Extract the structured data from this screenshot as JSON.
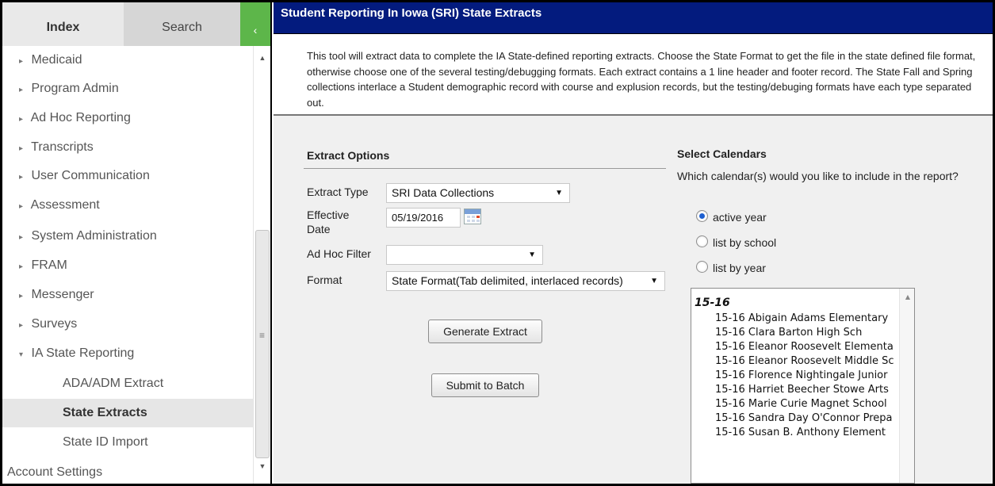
{
  "nav": {
    "tabs": {
      "index": "Index",
      "search": "Search",
      "collapse": "‹"
    },
    "items": [
      {
        "label": "Medicaid",
        "arrow": "▸"
      },
      {
        "label": "Program Admin",
        "arrow": "▸"
      },
      {
        "label": "Ad Hoc Reporting",
        "arrow": "▸"
      },
      {
        "label": "Transcripts",
        "arrow": "▸"
      },
      {
        "label": "User Communication",
        "arrow": "▸"
      },
      {
        "label": "Assessment",
        "arrow": "▸"
      },
      {
        "label": "System Administration",
        "arrow": "▸"
      },
      {
        "label": "FRAM",
        "arrow": "▸"
      },
      {
        "label": "Messenger",
        "arrow": "▸"
      },
      {
        "label": "Surveys",
        "arrow": "▸"
      },
      {
        "label": "IA State Reporting",
        "arrow": "▾"
      }
    ],
    "sub_items": [
      "ADA/ADM Extract",
      "State Extracts",
      "State ID Import"
    ],
    "account_settings": "Account Settings"
  },
  "main": {
    "title": "Student Reporting In Iowa (SRI) State Extracts",
    "description": "This tool will extract data to complete the IA State-defined reporting extracts. Choose the State Format to get the file in the state defined file format, otherwise choose one of the several testing/debugging formats. Each extract contains a 1 line header and footer record. The State Fall and Spring collections interlace a Student demographic record with course and explusion records, but the testing/debuging formats have each type separated out."
  },
  "extract_options": {
    "title": "Extract Options",
    "extract_type_label": "Extract Type",
    "extract_type_value": "SRI Data Collections",
    "effective_date_label": "Effective Date",
    "effective_date_value": "05/19/2016",
    "ad_hoc_filter_label": "Ad Hoc Filter",
    "ad_hoc_filter_value": "",
    "format_label": "Format",
    "format_value": "State Format(Tab delimited, interlaced records)",
    "generate_button": "Generate Extract",
    "submit_button": "Submit to Batch"
  },
  "calendars": {
    "title": "Select Calendars",
    "question": "Which calendar(s) would you like to include in the report?",
    "options": [
      "active year",
      "list by school",
      "list by year"
    ],
    "selected": "active year",
    "group": "15-16",
    "list": [
      "15-16 Abigain Adams Elementary",
      "15-16 Clara Barton High Sch",
      "15-16 Eleanor Roosevelt Elementa",
      "15-16 Eleanor Roosevelt Middle Sc",
      "15-16 Florence Nightingale Junior",
      "15-16 Harriet Beecher Stowe Arts",
      "15-16 Marie Curie Magnet School",
      "15-16 Sandra Day O'Connor Prepa",
      "15-16 Susan B. Anthony Element"
    ]
  },
  "colors": {
    "title_bar": "#031b7e",
    "collapse_green": "#5db64a",
    "radio_selected": "#1d5fd0"
  }
}
